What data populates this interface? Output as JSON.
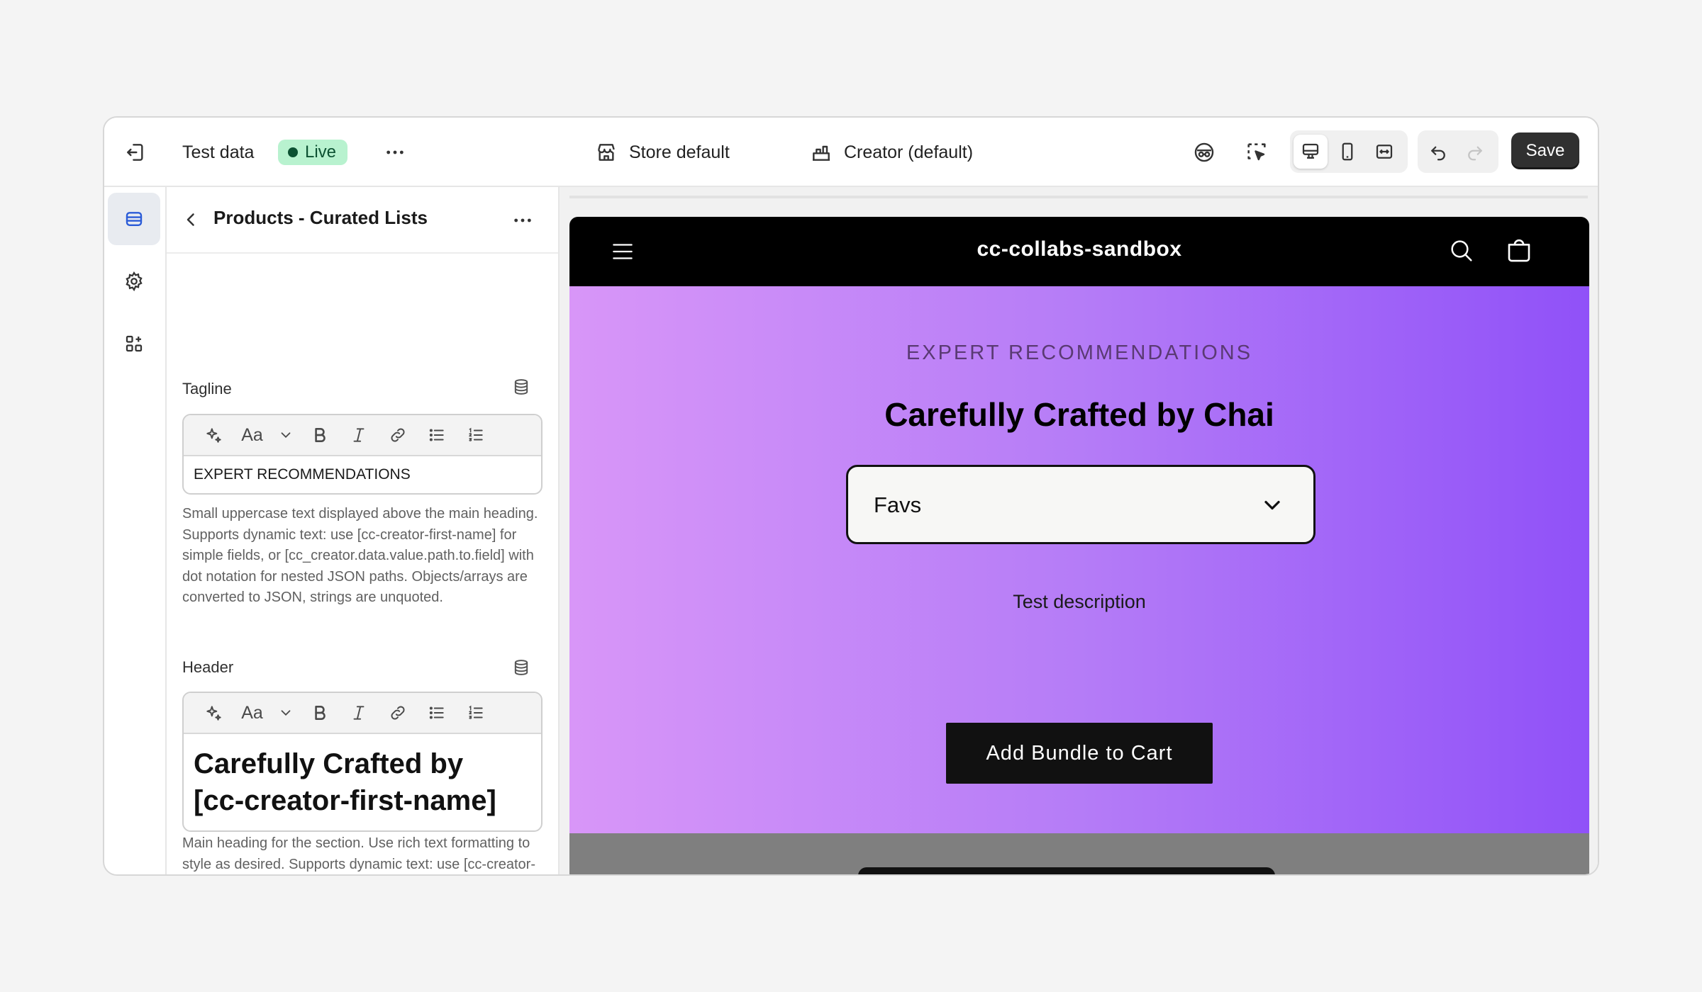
{
  "topbar": {
    "exit_icon": "exit-icon",
    "app_title": "Test data",
    "status_badge": "Live",
    "more_icon": "more-horizontal-icon",
    "store_selector": "Store default",
    "creator_selector": "Creator (default)",
    "save_label": "Save"
  },
  "rail": {
    "items": [
      "sections-icon",
      "settings-gear-icon",
      "apps-icon"
    ]
  },
  "panel": {
    "title": "Products - Curated Lists",
    "fields": [
      {
        "label": "Tagline",
        "value": "EXPERT RECOMMENDATIONS",
        "help": "Small uppercase text displayed above the main heading. Supports dynamic text: use [cc-creator-first-name] for simple fields, or [cc_creator.data.value.path.to.field] with dot notation for nested JSON paths. Objects/arrays are converted to JSON, strings are unquoted."
      },
      {
        "label": "Header",
        "value_line1": "Carefully Crafted by",
        "value_line2": "[cc-creator-first-name]",
        "help": "Main heading for the section. Use rich text formatting to style as desired. Supports dynamic text: use [cc-creator-first-name] for simple fields, or [cc_creator.data.value.path.to.field] with dot notation for nested JSON paths. Objects/arrays are converted to JSON, strings are unquoted."
      }
    ],
    "toolbar": {
      "font_label": "Aa"
    }
  },
  "preview": {
    "site_name": "cc-collabs-sandbox",
    "tagline": "EXPERT RECOMMENDATIONS",
    "heading": "Carefully Crafted by Chai",
    "select_value": "Favs",
    "description": "Test description",
    "cta_label": "Add Bundle to Cart"
  },
  "colors": {
    "live_badge_bg": "#b8f2cf",
    "save_bg": "#303030",
    "hero_gradient_start": "#d896f8",
    "hero_gradient_end": "#9051f8"
  }
}
